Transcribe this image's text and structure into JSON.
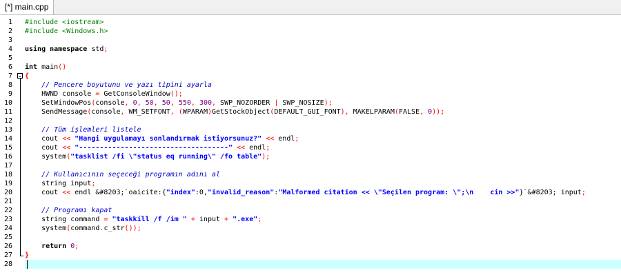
{
  "tab": {
    "title": "[*] main.cpp"
  },
  "editor": {
    "current_line": 28,
    "fold_start_line": 7,
    "fold_end_line": 27,
    "lines": [
      {
        "n": "1",
        "tokens": [
          {
            "t": "#include <iostream>",
            "c": "pp"
          }
        ]
      },
      {
        "n": "2",
        "tokens": [
          {
            "t": "#include <Windows.h>",
            "c": "pp"
          }
        ]
      },
      {
        "n": "3",
        "tokens": []
      },
      {
        "n": "4",
        "tokens": [
          {
            "t": "using namespace",
            "c": "kw"
          },
          {
            "t": " std",
            "c": "pl"
          },
          {
            "t": ";",
            "c": "op"
          }
        ]
      },
      {
        "n": "5",
        "tokens": []
      },
      {
        "n": "6",
        "tokens": [
          {
            "t": "int",
            "c": "kw"
          },
          {
            "t": " main",
            "c": "pl"
          },
          {
            "t": "()",
            "c": "op"
          }
        ]
      },
      {
        "n": "7",
        "tokens": [
          {
            "t": "{",
            "c": "bk"
          }
        ]
      },
      {
        "n": "8",
        "tokens": [
          {
            "t": "    // Pencere boyutunu ve yazı tipini ayarla",
            "c": "cm"
          }
        ]
      },
      {
        "n": "9",
        "tokens": [
          {
            "t": "    HWND console ",
            "c": "pl"
          },
          {
            "t": "=",
            "c": "op"
          },
          {
            "t": " GetConsoleWindow",
            "c": "pl"
          },
          {
            "t": "();",
            "c": "op"
          }
        ]
      },
      {
        "n": "10",
        "tokens": [
          {
            "t": "    SetWindowPos",
            "c": "pl"
          },
          {
            "t": "(",
            "c": "op"
          },
          {
            "t": "console",
            "c": "pl"
          },
          {
            "t": ", ",
            "c": "op"
          },
          {
            "t": "0",
            "c": "nm"
          },
          {
            "t": ", ",
            "c": "op"
          },
          {
            "t": "50",
            "c": "nm"
          },
          {
            "t": ", ",
            "c": "op"
          },
          {
            "t": "50",
            "c": "nm"
          },
          {
            "t": ", ",
            "c": "op"
          },
          {
            "t": "550",
            "c": "nm"
          },
          {
            "t": ", ",
            "c": "op"
          },
          {
            "t": "300",
            "c": "nm"
          },
          {
            "t": ", ",
            "c": "op"
          },
          {
            "t": "SWP_NOZORDER ",
            "c": "pl"
          },
          {
            "t": "|",
            "c": "op"
          },
          {
            "t": " SWP_NOSIZE",
            "c": "pl"
          },
          {
            "t": ");",
            "c": "op"
          }
        ]
      },
      {
        "n": "11",
        "tokens": [
          {
            "t": "    SendMessage",
            "c": "pl"
          },
          {
            "t": "(",
            "c": "op"
          },
          {
            "t": "console",
            "c": "pl"
          },
          {
            "t": ", ",
            "c": "op"
          },
          {
            "t": "WM_SETFONT",
            "c": "pl"
          },
          {
            "t": ", ",
            "c": "op"
          },
          {
            "t": "(",
            "c": "op"
          },
          {
            "t": "WPARAM",
            "c": "pl"
          },
          {
            "t": ")",
            "c": "op"
          },
          {
            "t": "GetStockObject",
            "c": "pl"
          },
          {
            "t": "(",
            "c": "op"
          },
          {
            "t": "DEFAULT_GUI_FONT",
            "c": "pl"
          },
          {
            "t": "), ",
            "c": "op"
          },
          {
            "t": "MAKELPARAM",
            "c": "pl"
          },
          {
            "t": "(",
            "c": "op"
          },
          {
            "t": "FALSE",
            "c": "pl"
          },
          {
            "t": ", ",
            "c": "op"
          },
          {
            "t": "0",
            "c": "nm"
          },
          {
            "t": "));",
            "c": "op"
          }
        ]
      },
      {
        "n": "12",
        "tokens": []
      },
      {
        "n": "13",
        "tokens": [
          {
            "t": "    // Tüm işlemleri listele",
            "c": "cm"
          }
        ]
      },
      {
        "n": "14",
        "tokens": [
          {
            "t": "    cout ",
            "c": "pl"
          },
          {
            "t": "<<",
            "c": "op"
          },
          {
            "t": " ",
            "c": "pl"
          },
          {
            "t": "\"Hangi uygulamayı sonlandırmak istiyorsunuz?\"",
            "c": "st"
          },
          {
            "t": " ",
            "c": "pl"
          },
          {
            "t": "<<",
            "c": "op"
          },
          {
            "t": " endl",
            "c": "pl"
          },
          {
            "t": ";",
            "c": "op"
          }
        ]
      },
      {
        "n": "15",
        "tokens": [
          {
            "t": "    cout ",
            "c": "pl"
          },
          {
            "t": "<<",
            "c": "op"
          },
          {
            "t": " ",
            "c": "pl"
          },
          {
            "t": "\"------------------------------------\"",
            "c": "st"
          },
          {
            "t": " ",
            "c": "pl"
          },
          {
            "t": "<<",
            "c": "op"
          },
          {
            "t": " endl",
            "c": "pl"
          },
          {
            "t": ";",
            "c": "op"
          }
        ]
      },
      {
        "n": "16",
        "tokens": [
          {
            "t": "    system",
            "c": "pl"
          },
          {
            "t": "(",
            "c": "op"
          },
          {
            "t": "\"tasklist /fi \\\"status eq running\\\" /fo table\"",
            "c": "st"
          },
          {
            "t": ");",
            "c": "op"
          }
        ]
      },
      {
        "n": "17",
        "tokens": []
      },
      {
        "n": "18",
        "tokens": [
          {
            "t": "    // Kullanıcının seçeceği programın adını al",
            "c": "cm"
          }
        ]
      },
      {
        "n": "19",
        "tokens": [
          {
            "t": "    string input",
            "c": "pl"
          },
          {
            "t": ";",
            "c": "op"
          }
        ]
      },
      {
        "n": "20",
        "tokens": [
          {
            "t": "    cout ",
            "c": "pl"
          },
          {
            "t": "<<",
            "c": "op"
          },
          {
            "t": " endl ",
            "c": "pl"
          },
          {
            "t": "&#8203;",
            "c": "pl"
          },
          {
            "t": "`oaicite:{",
            "c": "pl"
          },
          {
            "t": "\"index\"",
            "c": "st"
          },
          {
            "t": ":0,",
            "c": "pl"
          },
          {
            "t": "\"invalid_reason\"",
            "c": "st"
          },
          {
            "t": ":",
            "c": "pl"
          },
          {
            "t": "\"Malformed citation << \\\"Seçilen program: \\\";\\n    cin >>\"",
            "c": "st"
          },
          {
            "t": "}`&#8203;",
            "c": "pl"
          },
          {
            "t": " input",
            "c": "pl"
          },
          {
            "t": ";",
            "c": "op"
          }
        ]
      },
      {
        "n": "21",
        "tokens": []
      },
      {
        "n": "22",
        "tokens": [
          {
            "t": "    // Programı kapat",
            "c": "cm"
          }
        ]
      },
      {
        "n": "23",
        "tokens": [
          {
            "t": "    string command ",
            "c": "pl"
          },
          {
            "t": "=",
            "c": "op"
          },
          {
            "t": " ",
            "c": "pl"
          },
          {
            "t": "\"taskkill /f /im \"",
            "c": "st"
          },
          {
            "t": " ",
            "c": "pl"
          },
          {
            "t": "+",
            "c": "op"
          },
          {
            "t": " input ",
            "c": "pl"
          },
          {
            "t": "+",
            "c": "op"
          },
          {
            "t": " ",
            "c": "pl"
          },
          {
            "t": "\".exe\"",
            "c": "st"
          },
          {
            "t": ";",
            "c": "op"
          }
        ]
      },
      {
        "n": "24",
        "tokens": [
          {
            "t": "    system",
            "c": "pl"
          },
          {
            "t": "(",
            "c": "op"
          },
          {
            "t": "command",
            "c": "pl"
          },
          {
            "t": ".",
            "c": "op"
          },
          {
            "t": "c_str",
            "c": "pl"
          },
          {
            "t": "());",
            "c": "op"
          }
        ]
      },
      {
        "n": "25",
        "tokens": []
      },
      {
        "n": "26",
        "tokens": [
          {
            "t": "    return",
            "c": "kw"
          },
          {
            "t": " ",
            "c": "pl"
          },
          {
            "t": "0",
            "c": "nm"
          },
          {
            "t": ";",
            "c": "op"
          }
        ]
      },
      {
        "n": "27",
        "tokens": [
          {
            "t": "}",
            "c": "bk"
          }
        ]
      },
      {
        "n": "28",
        "tokens": []
      }
    ]
  }
}
